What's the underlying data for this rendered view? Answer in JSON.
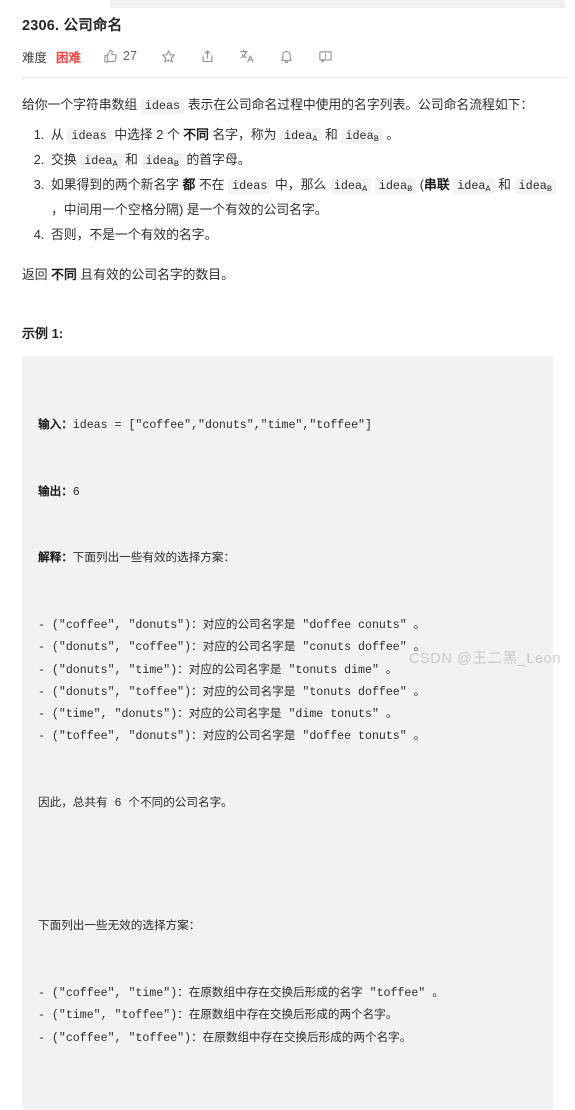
{
  "problem": {
    "title": "2306. 公司命名",
    "difficulty_label": "难度",
    "difficulty_value": "困难",
    "difficulty_color": "#ef4743",
    "like_count": "27",
    "icons": {
      "thumbs_up": "thumbs-up-icon",
      "star": "star-icon",
      "share": "share-icon",
      "translate": "translate-icon",
      "bell": "bell-icon",
      "comment": "comment-icon"
    }
  },
  "description": {
    "intro_part1": "给你一个字符串数组 ",
    "intro_code": "ideas",
    "intro_part2": " 表示在公司命名过程中使用的名字列表。公司命名流程如下：",
    "steps": [
      {
        "parts": [
          {
            "t": "text",
            "v": "从 "
          },
          {
            "t": "code",
            "v": "ideas"
          },
          {
            "t": "text",
            "v": " 中选择 2 个 "
          },
          {
            "t": "bold",
            "v": "不同"
          },
          {
            "t": "text",
            "v": " 名字，称为 "
          },
          {
            "t": "code",
            "v": "idea",
            "sub": "A"
          },
          {
            "t": "text",
            "v": " 和 "
          },
          {
            "t": "code",
            "v": "idea",
            "sub": "B"
          },
          {
            "t": "text",
            "v": " 。"
          }
        ]
      },
      {
        "parts": [
          {
            "t": "text",
            "v": "交换 "
          },
          {
            "t": "code",
            "v": "idea",
            "sub": "A"
          },
          {
            "t": "text",
            "v": " 和 "
          },
          {
            "t": "code",
            "v": "idea",
            "sub": "B"
          },
          {
            "t": "text",
            "v": " 的首字母。"
          }
        ]
      },
      {
        "parts": [
          {
            "t": "text",
            "v": "如果得到的两个新名字 "
          },
          {
            "t": "bold",
            "v": "都"
          },
          {
            "t": "text",
            "v": " 不在 "
          },
          {
            "t": "code",
            "v": "ideas"
          },
          {
            "t": "text",
            "v": " 中，那么 "
          },
          {
            "t": "code",
            "v": "idea",
            "sub": "A"
          },
          {
            "t": "text",
            "v": " "
          },
          {
            "t": "code",
            "v": "idea",
            "sub": "B"
          },
          {
            "t": "text",
            "v": " ("
          },
          {
            "t": "bold",
            "v": "串联"
          },
          {
            "t": "text",
            "v": " "
          },
          {
            "t": "code",
            "v": "idea",
            "sub": "A"
          },
          {
            "t": "text",
            "v": " 和 "
          },
          {
            "t": "code",
            "v": "idea",
            "sub": "B"
          },
          {
            "t": "text",
            "v": " ，中间用一个空格分隔) 是一个有效的公司名字。"
          }
        ]
      },
      {
        "parts": [
          {
            "t": "text",
            "v": "否则，不是一个有效的名字。"
          }
        ]
      }
    ],
    "return_part1": "返回 ",
    "return_bold": "不同",
    "return_part2": " 且有效的公司名字的数目。"
  },
  "example": {
    "heading": "示例 1:",
    "input_label": "输入：",
    "input_value": "ideas = [\"coffee\",\"donuts\",\"time\",\"toffee\"]",
    "output_label": "输出：",
    "output_value": "6",
    "explain_label": "解释：",
    "explain_value": "下面列出一些有效的选择方案：",
    "valid_cases": [
      "- (\"coffee\", \"donuts\")：对应的公司名字是 \"doffee conuts\" 。",
      "- (\"donuts\", \"coffee\")：对应的公司名字是 \"conuts doffee\" 。",
      "- (\"donuts\", \"time\")：对应的公司名字是 \"tonuts dime\" 。",
      "- (\"donuts\", \"toffee\")：对应的公司名字是 \"tonuts doffee\" 。",
      "- (\"time\", \"donuts\")：对应的公司名字是 \"dime tonuts\" 。",
      "- (\"toffee\", \"donuts\")：对应的公司名字是 \"doffee tonuts\" 。"
    ],
    "total_line": "因此，总共有 6 个不同的公司名字。",
    "invalid_heading": "下面列出一些无效的选择方案：",
    "invalid_cases": [
      "- (\"coffee\", \"time\")：在原数组中存在交换后形成的名字 \"toffee\" 。",
      "- (\"time\", \"toffee\")：在原数组中存在交换后形成的两个名字。",
      "- (\"coffee\", \"toffee\")：在原数组中存在交换后形成的两个名字。"
    ]
  },
  "watermark": "CSDN @王二黑_Leon"
}
